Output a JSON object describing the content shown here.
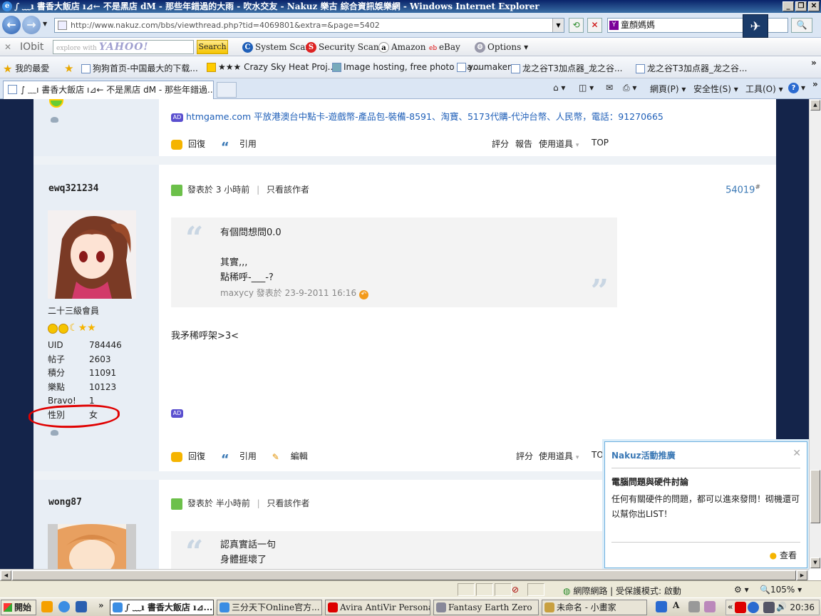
{
  "window": {
    "title": "∫ ﹏ı 書香大飯店 ı⊿← 不是黑店 dM - 那些年錯過的大雨 - 吹水交友 - Nakuz 樂古 綜合資訊娛樂網 - Windows Internet Explorer"
  },
  "address": {
    "url": "http://www.nakuz.com/bbs/viewthread.php?tid=4069801&extra=&page=5402",
    "search_value": "童顏媽媽"
  },
  "toolbar": {
    "brand": "IObit",
    "yahoo_placeholder": "explore with",
    "yahoo_logo": "YAHOO! SEARCH",
    "search_label": "Search",
    "system_scan": "System Scan",
    "security_scan": "Security Scan",
    "amazon": "Amazon",
    "ebay": "eBay",
    "options": "Options"
  },
  "favorites": {
    "label": "我的最愛",
    "items": [
      "狗狗首页-中国最大的下载...",
      "★★★ Crazy Sky Heat Proj...",
      "Image hosting, free photo sha...",
      "youmaker",
      "龙之谷T3加点器_龙之谷...",
      "龙之谷T3加点器_龙之谷..."
    ]
  },
  "tab": {
    "label": "∫ ﹏ı 書香大飯店 ı⊿← 不是黑店 dM - 那些年錯過..."
  },
  "commands": {
    "page": "網頁(P)",
    "safety": "安全性(S)",
    "tools": "工具(O)"
  },
  "ad_line": "htmgame.com 平放港澳台中點卡-遊戲幣-產品包-裝備-8591、淘寶、5173代購-代沖台幣、人民幣，電話：91270665",
  "actions": {
    "reply": "回復",
    "quote": "引用",
    "edit": "編輯",
    "rate": "評分",
    "report": "報告",
    "tools": "使用道具",
    "top": "TOP"
  },
  "post1": {
    "username": "ewq321234",
    "rank": "二十三級會員",
    "stats": [
      {
        "k": "UID",
        "v": "784446"
      },
      {
        "k": "帖子",
        "v": "2603"
      },
      {
        "k": "積分",
        "v": "11091"
      },
      {
        "k": "樂點",
        "v": "10123"
      },
      {
        "k": "Bravo!",
        "v": "1"
      },
      {
        "k": "性別",
        "v": "女"
      }
    ],
    "posted": "發表於 3 小時前",
    "author_only": "只看該作者",
    "floor": "54019",
    "floor_mark": "#",
    "quote_lines": "有個問想問0.0\n\n其實,,,\n點稀呼-___-?",
    "quote_meta": "maxycy 發表於 23-9-2011 16:16",
    "body": "我矛稀呼架>3<"
  },
  "post2": {
    "username": "wong87",
    "posted": "發表於 半小時前",
    "author_only": "只看該作者",
    "quote_lines": "認真實話一句\n身體捱壞了"
  },
  "popup": {
    "title": "Nakuz活動推廣",
    "subtitle": "電腦問題與硬件討論",
    "body": "任何有關硬件的問題，都可以進來發問！砌機還可以幫你出LIST！",
    "view": "查看"
  },
  "status": {
    "zone": "網際網路 | 受保護模式: 啟動",
    "zoom": "105%"
  },
  "taskbar": {
    "start": "開始",
    "items": [
      "∫ ﹏ı 書香大飯店 ı⊿...",
      "三分天下Online官方...",
      "Avira AntiVir Personal ...",
      "Fantasy Earth Zero",
      "未命名 - 小畫家"
    ],
    "time": "20:36"
  },
  "colors": {
    "accent_blue": "#3a78b5",
    "page_bg": "#14244a",
    "sidebar_bg": "#e8eef5",
    "annotation_red": "#e00000"
  }
}
